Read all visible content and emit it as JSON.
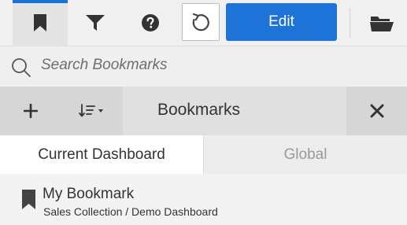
{
  "toolbar": {
    "edit_label": "Edit"
  },
  "search": {
    "placeholder": "Search Bookmarks"
  },
  "header": {
    "title": "Bookmarks"
  },
  "tabs": [
    {
      "label": "Current Dashboard",
      "active": true
    },
    {
      "label": "Global",
      "active": false
    }
  ],
  "bookmarks": [
    {
      "name": "My Bookmark",
      "path": "Sales Collection / Demo Dashboard"
    }
  ],
  "colors": {
    "accent": "#1e73d9",
    "icon": "#333333"
  },
  "icons": [
    "bookmark-icon",
    "filter-icon",
    "help-icon",
    "reload-icon",
    "folder-icon",
    "search-icon",
    "plus-icon",
    "sort-icon",
    "close-icon"
  ]
}
